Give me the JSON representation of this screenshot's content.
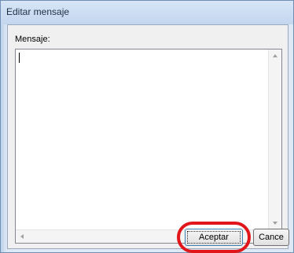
{
  "window": {
    "title": "Editar mensaje"
  },
  "form": {
    "label": "Mensaje:",
    "message_value": ""
  },
  "buttons": {
    "accept": "Aceptar",
    "cancel": "Cance"
  },
  "annotation": {
    "highlight_color": "#e0161b",
    "highlighted": "accept-button"
  }
}
